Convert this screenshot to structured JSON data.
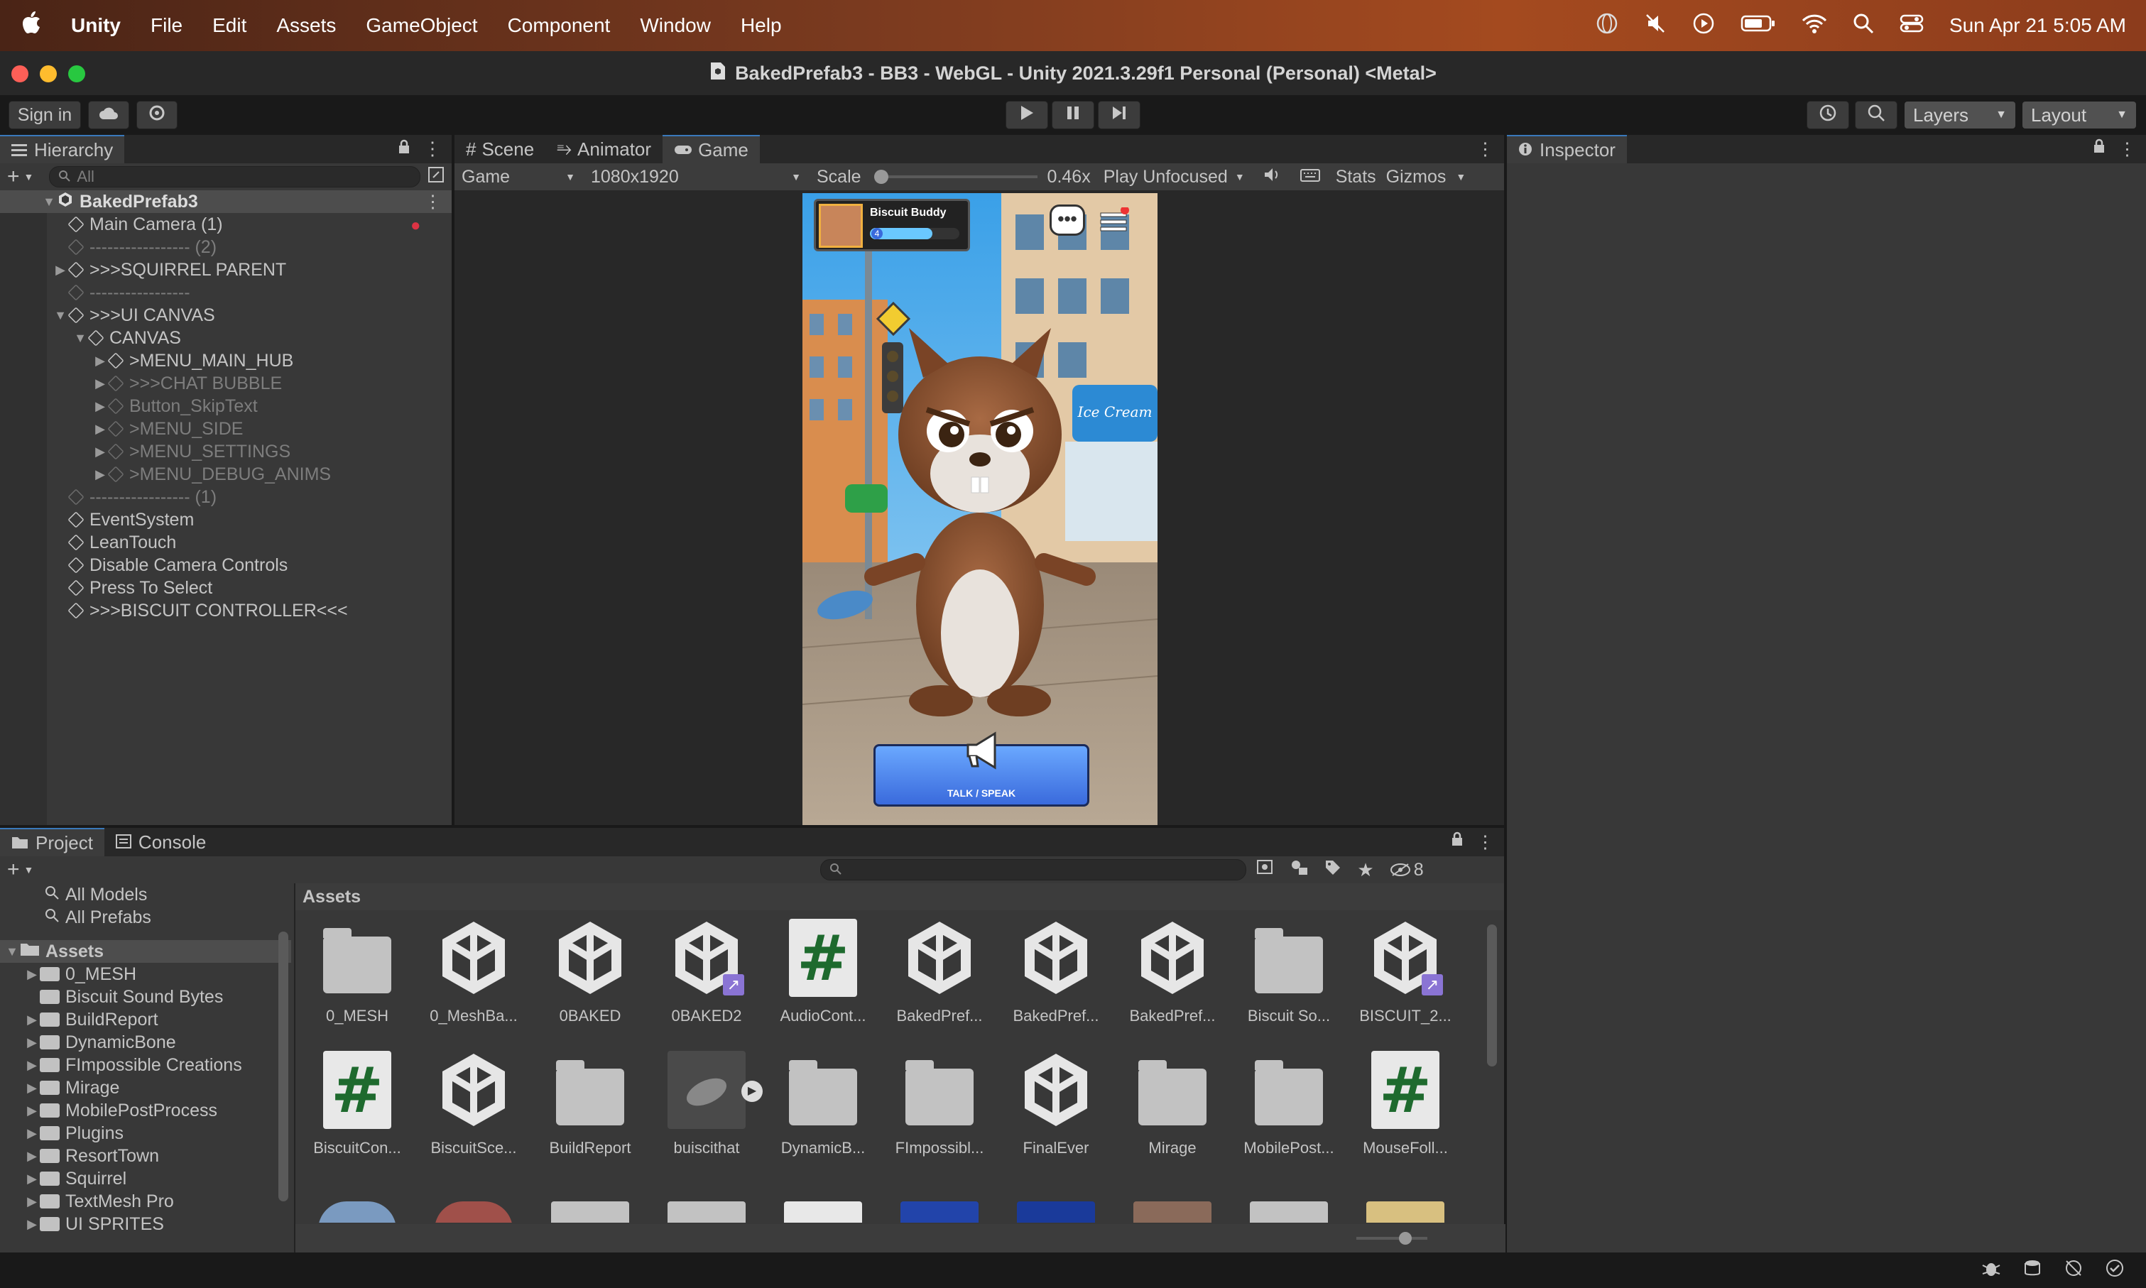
{
  "menubar": {
    "apple": "",
    "items": [
      "Unity",
      "File",
      "Edit",
      "Assets",
      "GameObject",
      "Component",
      "Window",
      "Help"
    ],
    "clock": "Sun Apr 21  5:05 AM"
  },
  "window": {
    "title": "BakedPrefab3 - BB3 - WebGL - Unity 2021.3.29f1 Personal (Personal) <Metal>"
  },
  "toolbar": {
    "sign_in": "Sign in",
    "layers": "Layers",
    "layout": "Layout"
  },
  "hierarchy": {
    "tab": "Hierarchy",
    "search_placeholder": "All",
    "scene": "BakedPrefab3",
    "rows": [
      {
        "label": "Main Camera (1)",
        "indent": 1,
        "arrow": "",
        "dim": false
      },
      {
        "label": "----------------- (2)",
        "indent": 1,
        "arrow": "",
        "dim": true
      },
      {
        "label": ">>>SQUIRREL PARENT",
        "indent": 1,
        "arrow": "▶",
        "dim": false
      },
      {
        "label": "-----------------",
        "indent": 1,
        "arrow": "",
        "dim": true
      },
      {
        "label": ">>>UI CANVAS",
        "indent": 1,
        "arrow": "▼",
        "dim": false
      },
      {
        "label": "CANVAS",
        "indent": 2,
        "arrow": "▼",
        "dim": false
      },
      {
        "label": ">MENU_MAIN_HUB",
        "indent": 3,
        "arrow": "▶",
        "dim": false
      },
      {
        "label": ">>>CHAT BUBBLE",
        "indent": 3,
        "arrow": "▶",
        "dim": true
      },
      {
        "label": "Button_SkipText",
        "indent": 3,
        "arrow": "▶",
        "dim": true
      },
      {
        "label": ">MENU_SIDE",
        "indent": 3,
        "arrow": "▶",
        "dim": true
      },
      {
        "label": ">MENU_SETTINGS",
        "indent": 3,
        "arrow": "▶",
        "dim": true
      },
      {
        "label": ">MENU_DEBUG_ANIMS",
        "indent": 3,
        "arrow": "▶",
        "dim": true
      },
      {
        "label": "----------------- (1)",
        "indent": 1,
        "arrow": "",
        "dim": true
      },
      {
        "label": "EventSystem",
        "indent": 1,
        "arrow": "",
        "dim": false
      },
      {
        "label": "LeanTouch",
        "indent": 1,
        "arrow": "",
        "dim": false
      },
      {
        "label": "Disable Camera Controls",
        "indent": 1,
        "arrow": "",
        "dim": false
      },
      {
        "label": "Press To Select",
        "indent": 1,
        "arrow": "",
        "dim": false
      },
      {
        "label": ">>>BISCUIT CONTROLLER<<<",
        "indent": 1,
        "arrow": "",
        "dim": false
      }
    ]
  },
  "center": {
    "tabs": [
      "Scene",
      "Animator",
      "Game"
    ],
    "display": "Game",
    "resolution": "1080x1920",
    "scale_label": "Scale",
    "scale_value": "0.46x",
    "play_mode": "Play Unfocused",
    "stats": "Stats",
    "gizmos": "Gizmos"
  },
  "game": {
    "player_name": "Biscuit Buddy",
    "level": "4",
    "talk_button": "TALK / SPEAK",
    "store_sign": "Ice Cream"
  },
  "inspector": {
    "tab": "Inspector"
  },
  "project": {
    "tabs": [
      "Project",
      "Console"
    ],
    "hidden_count": "8",
    "favorites": [
      "All Models",
      "All Prefabs"
    ],
    "root": "Assets",
    "folders": [
      {
        "label": "0_MESH",
        "arrow": "▶"
      },
      {
        "label": "Biscuit Sound Bytes",
        "arrow": ""
      },
      {
        "label": "BuildReport",
        "arrow": "▶"
      },
      {
        "label": "DynamicBone",
        "arrow": "▶"
      },
      {
        "label": "FImpossible Creations",
        "arrow": "▶"
      },
      {
        "label": "Mirage",
        "arrow": "▶"
      },
      {
        "label": "MobilePostProcess",
        "arrow": "▶"
      },
      {
        "label": "Plugins",
        "arrow": "▶"
      },
      {
        "label": "ResortTown",
        "arrow": "▶"
      },
      {
        "label": "Squirrel",
        "arrow": "▶"
      },
      {
        "label": "TextMesh Pro",
        "arrow": "▶"
      },
      {
        "label": "UI SPRITES",
        "arrow": "▶"
      }
    ],
    "breadcrumb": "Assets",
    "assets_row1": [
      {
        "label": "0_MESH",
        "type": "folder"
      },
      {
        "label": "0_MeshBa...",
        "type": "unity"
      },
      {
        "label": "0BAKED",
        "type": "unity"
      },
      {
        "label": "0BAKED2",
        "type": "unity-link"
      },
      {
        "label": "AudioCont...",
        "type": "script"
      },
      {
        "label": "BakedPref...",
        "type": "unity"
      },
      {
        "label": "BakedPref...",
        "type": "unity"
      },
      {
        "label": "BakedPref...",
        "type": "unity"
      },
      {
        "label": "Biscuit So...",
        "type": "folder"
      },
      {
        "label": "BISCUIT_2...",
        "type": "unity-link"
      }
    ],
    "assets_row2": [
      {
        "label": "BiscuitCon...",
        "type": "script"
      },
      {
        "label": "BiscuitSce...",
        "type": "unity"
      },
      {
        "label": "BuildReport",
        "type": "folder"
      },
      {
        "label": "buiscithat",
        "type": "model"
      },
      {
        "label": "DynamicB...",
        "type": "folder"
      },
      {
        "label": "FImpossibl...",
        "type": "folder"
      },
      {
        "label": "FinalEver",
        "type": "unity"
      },
      {
        "label": "Mirage",
        "type": "folder"
      },
      {
        "label": "MobilePost...",
        "type": "folder"
      },
      {
        "label": "MouseFoll...",
        "type": "script"
      }
    ]
  },
  "colors": {
    "accent": "#3a79bb",
    "panel": "#383838",
    "toolbar": "#191919"
  }
}
